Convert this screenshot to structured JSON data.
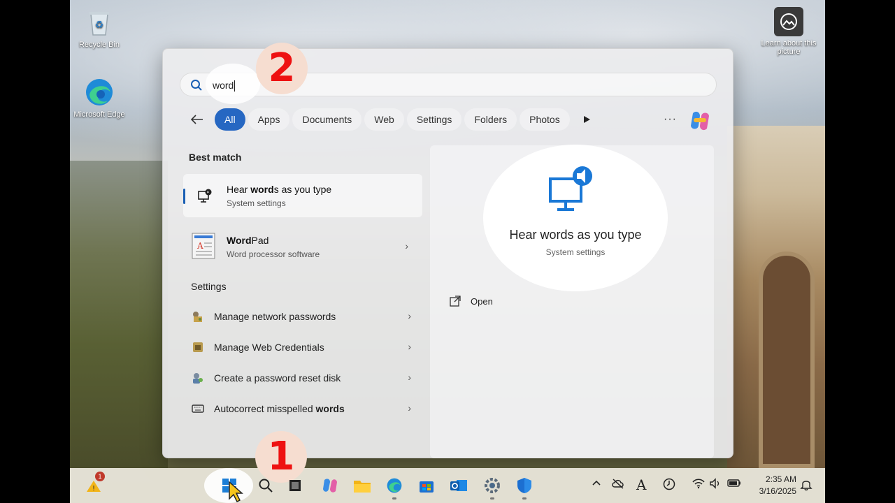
{
  "desktop": {
    "icons": [
      {
        "label": "Recycle Bin"
      },
      {
        "label": "Microsoft Edge"
      }
    ],
    "learn_about": "Learn about this picture"
  },
  "search": {
    "query": "word",
    "step_badge": "2"
  },
  "filters": {
    "tabs": [
      "All",
      "Apps",
      "Documents",
      "Web",
      "Settings",
      "Folders",
      "Photos"
    ],
    "active": "All",
    "more": "···"
  },
  "best_match": {
    "heading": "Best match",
    "title_pre": "Hear ",
    "title_bold": "word",
    "title_post": "s as you type",
    "subtitle": "System settings"
  },
  "apps": {
    "wordpad": {
      "title_bold": "Word",
      "title_post": "Pad",
      "subtitle": "Word processor software"
    }
  },
  "settings": {
    "heading": "Settings",
    "items": [
      {
        "label": "Manage network passwords"
      },
      {
        "label": "Manage Web Credentials"
      },
      {
        "label": "Create a password reset disk"
      },
      {
        "label_pre": "Autocorrect misspelled ",
        "label_bold": "words"
      }
    ]
  },
  "detail": {
    "title": "Hear words as you type",
    "subtitle": "System settings",
    "open_label": "Open"
  },
  "taskbar": {
    "step_badge": "1",
    "notification_count": "1",
    "time": "2:35 AM",
    "date": "3/16/2025",
    "icons": [
      "start-icon",
      "search-icon",
      "task-view-icon",
      "copilot-icon",
      "file-explorer-icon",
      "edge-icon",
      "store-icon",
      "outlook-icon",
      "settings-icon",
      "defender-icon"
    ],
    "tray_icons": [
      "chevron-up-icon",
      "cloud-off-icon",
      "font-a-icon",
      "clock-icon",
      "wifi-icon",
      "volume-icon",
      "battery-icon",
      "notification-bell-icon"
    ],
    "tray_font_a": "A"
  },
  "colors": {
    "accent": "#2667c2",
    "badge_text": "#e11111",
    "badge_bg": "#f6ddd0"
  }
}
